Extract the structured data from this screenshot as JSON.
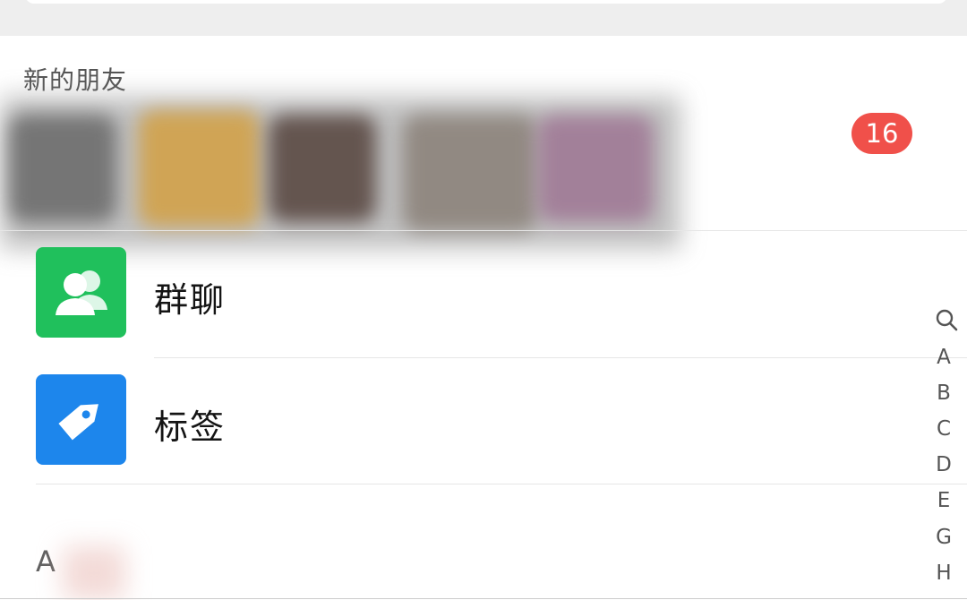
{
  "new_friends": {
    "title": "新的朋友",
    "badge_count": "16",
    "badge_color": "#f0504a"
  },
  "menu": {
    "group_chat": {
      "label": "群聊",
      "icon": "people-icon",
      "color": "#20c05c"
    },
    "tags": {
      "label": "标签",
      "icon": "tag-icon",
      "color": "#1d86ec"
    }
  },
  "section": {
    "letter": "A"
  },
  "alpha_index": {
    "icon": "search-icon",
    "letters": [
      "A",
      "B",
      "C",
      "D",
      "E",
      "G",
      "H"
    ]
  }
}
